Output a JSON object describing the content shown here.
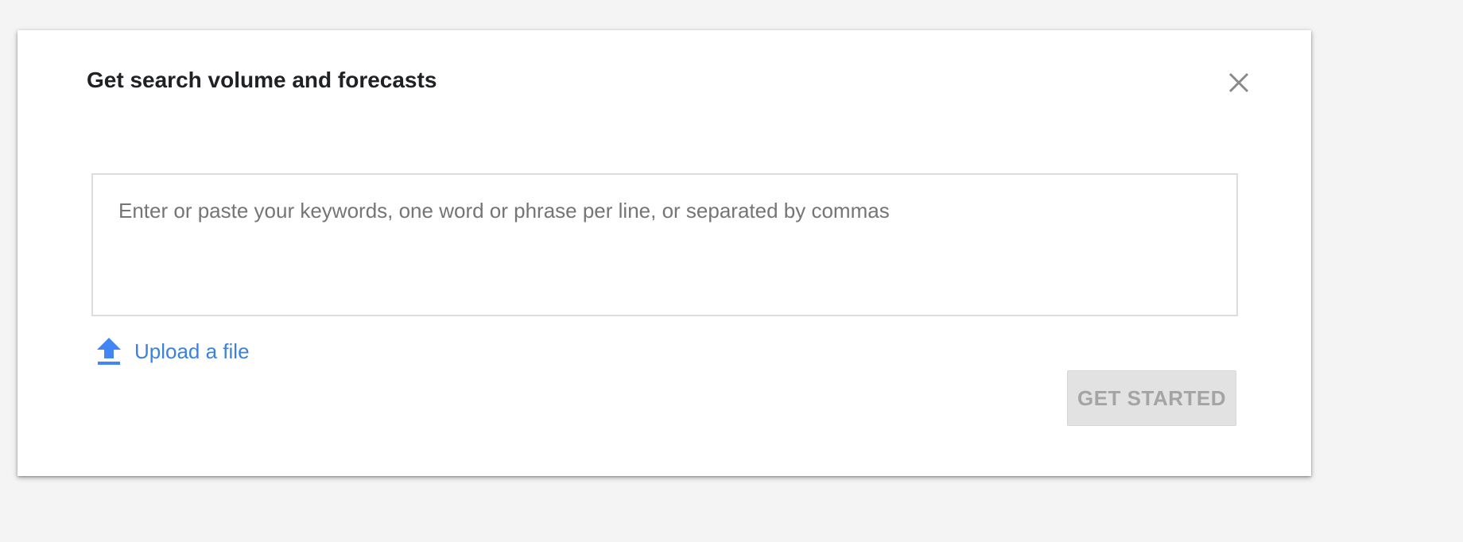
{
  "dialog": {
    "title": "Get search volume and forecasts",
    "close_icon": "close-icon",
    "keywords_input": {
      "value": "",
      "placeholder": "Enter or paste your keywords, one word or phrase per line, or separated by commas"
    },
    "upload": {
      "icon": "upload-icon",
      "label": "Upload a file"
    },
    "primary_button": {
      "label": "GET STARTED",
      "state": "disabled"
    }
  },
  "colors": {
    "page_background": "#f4f4f4",
    "dialog_background": "#ffffff",
    "link_blue": "#3b82e0",
    "upload_icon_blue": "#4285f4",
    "disabled_button_bg": "#e2e2e2",
    "disabled_button_text": "#a4a4a4",
    "close_icon_gray": "#8a8a8a"
  }
}
